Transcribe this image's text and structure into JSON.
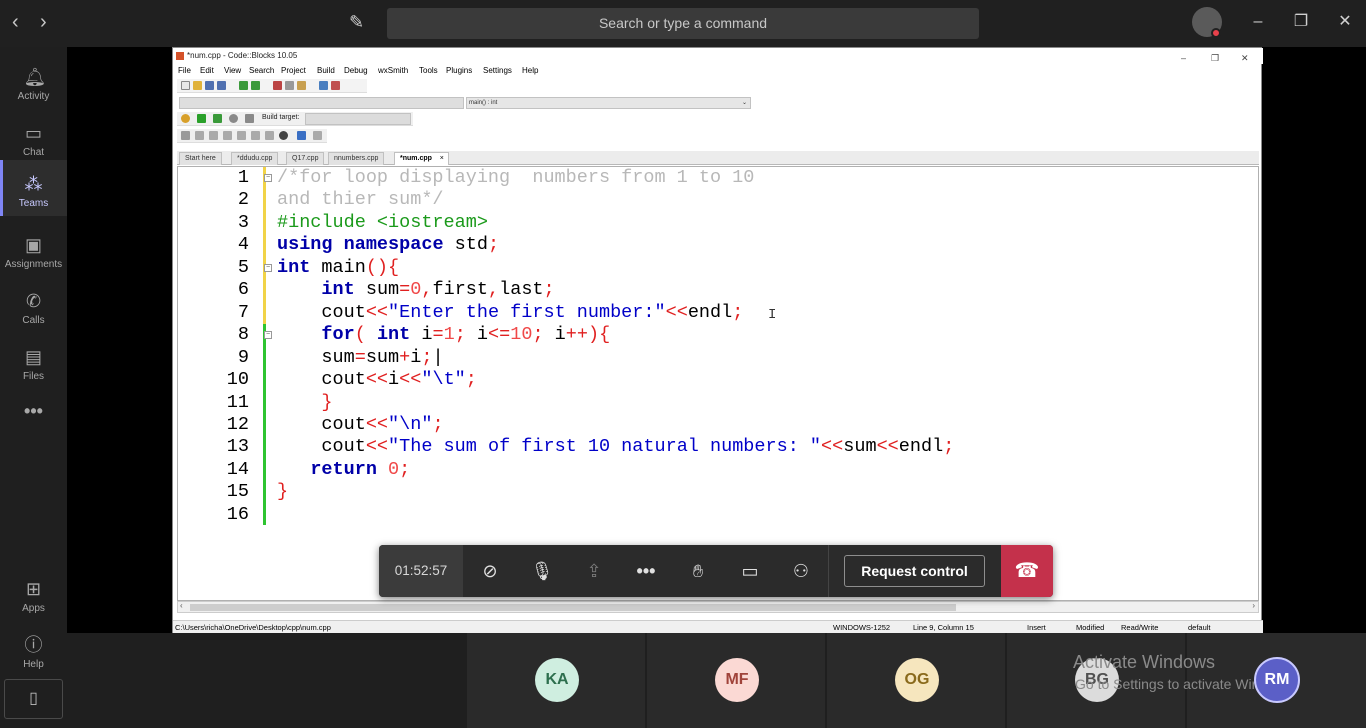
{
  "teams": {
    "search_placeholder": "Search or type a command",
    "rail": [
      {
        "label": "Activity",
        "icon": "bell-icon"
      },
      {
        "label": "Chat",
        "icon": "chat-icon"
      },
      {
        "label": "Teams",
        "icon": "teams-icon"
      },
      {
        "label": "Assignments",
        "icon": "assignments-icon"
      },
      {
        "label": "Calls",
        "icon": "phone-icon"
      },
      {
        "label": "Files",
        "icon": "files-icon"
      },
      {
        "label": "Apps",
        "icon": "apps-icon"
      },
      {
        "label": "Help",
        "icon": "help-icon"
      }
    ],
    "more_label": "•••",
    "accent": "#7f85f5"
  },
  "codeblocks": {
    "title": "*num.cpp - Code::Blocks 10.05",
    "menu": [
      "File",
      "Edit",
      "View",
      "Search",
      "Project",
      "Build",
      "Debug",
      "wxSmith",
      "Tools",
      "Plugins",
      "Settings",
      "Help"
    ],
    "scope_combo": "main() : int",
    "build_target_label": "Build target:",
    "tabs": [
      "Start here",
      "*ddudu.cpp",
      "Q17.cpp",
      "nnumbers.cpp",
      "*num.cpp"
    ],
    "active_tab": "*num.cpp",
    "line_numbers": [
      "1",
      "2",
      "3",
      "4",
      "5",
      "6",
      "7",
      "8",
      "9",
      "10",
      "11",
      "12",
      "13",
      "14",
      "15",
      "16"
    ],
    "status": {
      "path": "C:\\Users\\richa\\OneDrive\\Desktop\\cpp\\num.cpp",
      "encoding": "WINDOWS-1252",
      "position": "Line 9, Column 15",
      "mode": "Insert",
      "modified": "Modified",
      "access": "Read/Write",
      "lang": "default"
    }
  },
  "code": [
    [
      {
        "c": "cm",
        "t": "/*for loop displaying  numbers from 1 to 10"
      }
    ],
    [
      {
        "c": "cm",
        "t": "and thier sum*/"
      }
    ],
    [
      {
        "c": "pp",
        "t": "#include <iostream>"
      }
    ],
    [
      {
        "c": "kw",
        "t": "using"
      },
      {
        "c": "",
        "t": " "
      },
      {
        "c": "kw",
        "t": "namespace"
      },
      {
        "c": "",
        "t": " std"
      },
      {
        "c": "op",
        "t": ";"
      }
    ],
    [
      {
        "c": "kw",
        "t": "int"
      },
      {
        "c": "",
        "t": " main"
      },
      {
        "c": "op",
        "t": "(){"
      }
    ],
    [
      {
        "c": "",
        "t": "    "
      },
      {
        "c": "kw",
        "t": "int"
      },
      {
        "c": "",
        "t": " sum"
      },
      {
        "c": "op",
        "t": "="
      },
      {
        "c": "num",
        "t": "0"
      },
      {
        "c": "op",
        "t": ","
      },
      {
        "c": "",
        "t": "first"
      },
      {
        "c": "op",
        "t": ","
      },
      {
        "c": "",
        "t": "last"
      },
      {
        "c": "op",
        "t": ";"
      }
    ],
    [
      {
        "c": "",
        "t": "    cout"
      },
      {
        "c": "op",
        "t": "<<"
      },
      {
        "c": "str",
        "t": "\"Enter the first number:\""
      },
      {
        "c": "op",
        "t": "<<"
      },
      {
        "c": "",
        "t": "endl"
      },
      {
        "c": "op",
        "t": ";"
      }
    ],
    [
      {
        "c": "",
        "t": "    "
      },
      {
        "c": "kw",
        "t": "for"
      },
      {
        "c": "op",
        "t": "("
      },
      {
        "c": "",
        "t": " "
      },
      {
        "c": "kw",
        "t": "int"
      },
      {
        "c": "",
        "t": " i"
      },
      {
        "c": "op",
        "t": "="
      },
      {
        "c": "num",
        "t": "1"
      },
      {
        "c": "op",
        "t": ";"
      },
      {
        "c": "",
        "t": " i"
      },
      {
        "c": "op",
        "t": "<="
      },
      {
        "c": "num",
        "t": "10"
      },
      {
        "c": "op",
        "t": ";"
      },
      {
        "c": "",
        "t": " i"
      },
      {
        "c": "op",
        "t": "++){"
      }
    ],
    [
      {
        "c": "",
        "t": "    sum"
      },
      {
        "c": "op",
        "t": "="
      },
      {
        "c": "",
        "t": "sum"
      },
      {
        "c": "op",
        "t": "+"
      },
      {
        "c": "",
        "t": "i"
      },
      {
        "c": "op",
        "t": ";"
      },
      {
        "c": "",
        "t": "|"
      }
    ],
    [
      {
        "c": "",
        "t": "    cout"
      },
      {
        "c": "op",
        "t": "<<"
      },
      {
        "c": "",
        "t": "i"
      },
      {
        "c": "op",
        "t": "<<"
      },
      {
        "c": "str",
        "t": "\"\\t\""
      },
      {
        "c": "op",
        "t": ";"
      }
    ],
    [
      {
        "c": "",
        "t": "    "
      },
      {
        "c": "op",
        "t": "}"
      }
    ],
    [
      {
        "c": "",
        "t": "    cout"
      },
      {
        "c": "op",
        "t": "<<"
      },
      {
        "c": "str",
        "t": "\"\\n\""
      },
      {
        "c": "op",
        "t": ";"
      }
    ],
    [
      {
        "c": "",
        "t": "    cout"
      },
      {
        "c": "op",
        "t": "<<"
      },
      {
        "c": "str",
        "t": "\"The sum of first 10 natural numbers: \""
      },
      {
        "c": "op",
        "t": "<<"
      },
      {
        "c": "",
        "t": "sum"
      },
      {
        "c": "op",
        "t": "<<"
      },
      {
        "c": "",
        "t": "endl"
      },
      {
        "c": "op",
        "t": ";"
      }
    ],
    [
      {
        "c": "",
        "t": "   "
      },
      {
        "c": "kw",
        "t": "return"
      },
      {
        "c": "",
        "t": " "
      },
      {
        "c": "num",
        "t": "0"
      },
      {
        "c": "op",
        "t": ";"
      }
    ],
    [
      {
        "c": "op",
        "t": "}"
      }
    ],
    [
      {
        "c": "",
        "t": ""
      }
    ]
  ],
  "call": {
    "timer": "01:52:57",
    "request_control_label": "Request control",
    "participants": [
      {
        "initials": "KA",
        "bg": "#cfeee0",
        "fg": "#2d6f4e"
      },
      {
        "initials": "MF",
        "bg": "#fbd9d4",
        "fg": "#a0433a"
      },
      {
        "initials": "OG",
        "bg": "#f6e6be",
        "fg": "#8a6a1c"
      },
      {
        "initials": "BG",
        "bg": "#dcdcdc",
        "fg": "#505050"
      },
      {
        "initials": "RM",
        "bg": "#5b5fc7",
        "fg": "#ffffff"
      }
    ]
  },
  "watermark": {
    "line1": "Activate Windows",
    "line2": "Go to Settings to activate Windows."
  }
}
